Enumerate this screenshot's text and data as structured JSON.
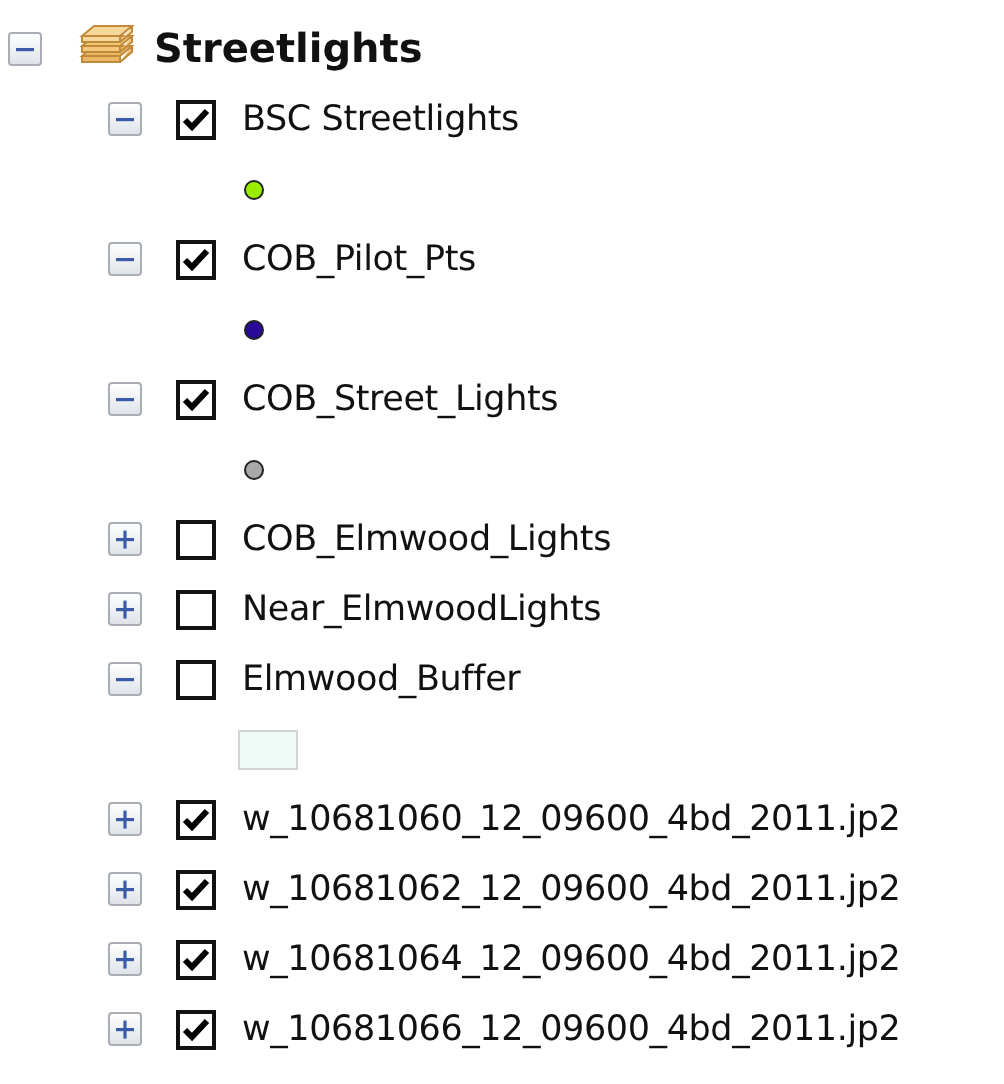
{
  "group": {
    "name": "Streetlights",
    "expanded": true,
    "layers": [
      {
        "name": "BSC Streetlights",
        "expanded": true,
        "visible": true,
        "symbol": {
          "kind": "point",
          "color": "#99ee00"
        }
      },
      {
        "name": "COB_Pilot_Pts",
        "expanded": true,
        "visible": true,
        "symbol": {
          "kind": "point",
          "color": "#2a0a99"
        }
      },
      {
        "name": "COB_Street_Lights",
        "expanded": true,
        "visible": true,
        "symbol": {
          "kind": "point",
          "color": "#a8a8a8"
        }
      },
      {
        "name": "COB_Elmwood_Lights",
        "expanded": false,
        "visible": false
      },
      {
        "name": "Near_ElmwoodLights",
        "expanded": false,
        "visible": false
      },
      {
        "name": "Elmwood_Buffer",
        "expanded": true,
        "visible": false,
        "symbol": {
          "kind": "polygon",
          "color": "#eefaf5"
        }
      },
      {
        "name": "w_10681060_12_09600_4bd_2011.jp2",
        "expanded": false,
        "visible": true
      },
      {
        "name": "w_10681062_12_09600_4bd_2011.jp2",
        "expanded": false,
        "visible": true
      },
      {
        "name": "w_10681064_12_09600_4bd_2011.jp2",
        "expanded": false,
        "visible": true
      },
      {
        "name": "w_10681066_12_09600_4bd_2011.jp2",
        "expanded": false,
        "visible": true
      }
    ]
  }
}
